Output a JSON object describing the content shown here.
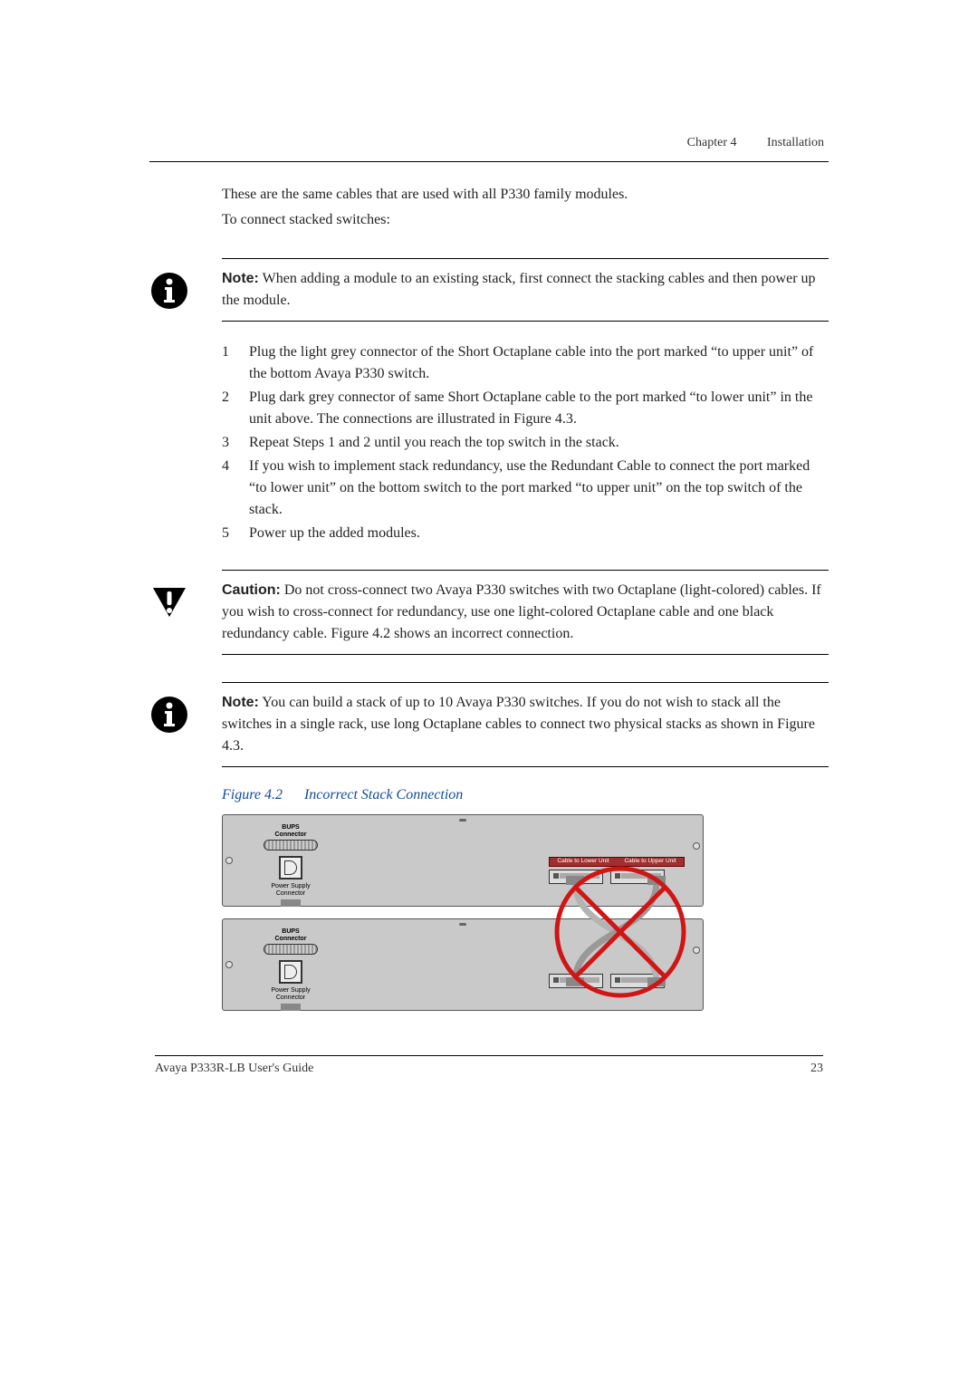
{
  "header": {
    "chapter": "Chapter 4",
    "title": "Installation"
  },
  "intro": {
    "line1": "These are the same cables that are used with all P330 family modules.",
    "line2": "To connect stacked switches:"
  },
  "note1": {
    "label": "Note:",
    "text": "When adding a module to an existing stack, first connect the stacking cables and then power up the module."
  },
  "steps": [
    {
      "n": "1",
      "text": "Plug the light grey connector of the Short Octaplane cable into the port marked “to upper unit” of the bottom Avaya P330 switch."
    },
    {
      "n": "2",
      "text": "Plug dark grey connector of same Short Octaplane cable to the port marked “to lower unit” in the unit above. The connections are illustrated in Figure 4.3."
    },
    {
      "n": "3",
      "text": "Repeat Steps 1 and 2 until you reach the top switch in the stack."
    },
    {
      "n": "4",
      "text": "If you wish to implement stack redundancy, use the Redundant Cable to connect the port marked “to lower unit” on the bottom switch to the port marked “to upper unit” on the top switch of the stack."
    },
    {
      "n": "5",
      "text": "Power up the added modules."
    }
  ],
  "caution": {
    "label": "Caution:",
    "text": "Do not cross-connect two Avaya P330 switches with two Octaplane (light-colored) cables. If you wish to cross-connect for redundancy, use one light-colored Octaplane cable and one black redundancy cable. Figure 4.2 shows an incorrect connection."
  },
  "note2": {
    "label": "Note:",
    "text": "You can build a stack of up to 10 Avaya P330 switches. If you do not wish to stack all the switches in a single rack, use long Octaplane cables to connect two physical stacks as shown in Figure 4.3."
  },
  "figure": {
    "number": "Figure 4.2",
    "title": "Incorrect Stack Connection",
    "labels": {
      "bups": "BUPS",
      "connector": "Connector",
      "power_supply": "Power Supply",
      "cable_lower": "Cable to Lower Unit",
      "cable_upper": "Cable to Upper Unit"
    }
  },
  "footer": {
    "guide": "Avaya P333R-LB User's Guide",
    "page": "23"
  }
}
